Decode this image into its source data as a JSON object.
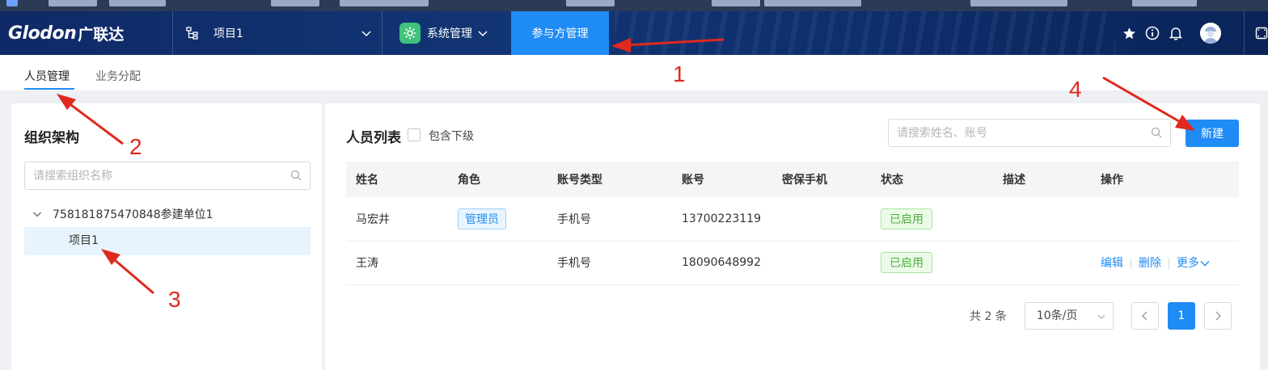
{
  "brand": {
    "logo_en": "Glodon",
    "logo_cn": "广联达"
  },
  "header": {
    "project_selector": "项目1",
    "system_menu": "系统管理",
    "active_tab": "参与方管理",
    "icons": [
      "star-icon",
      "info-icon",
      "bell-icon",
      "avatar",
      "fullscreen-icon"
    ]
  },
  "subtabs": [
    {
      "label": "人员管理",
      "active": true
    },
    {
      "label": "业务分配",
      "active": false
    }
  ],
  "left_panel": {
    "title": "组织架构",
    "search_placeholder": "请搜索组织名称",
    "tree": {
      "root": "758181875470848参建单位1",
      "child": "项目1"
    }
  },
  "right_panel": {
    "title": "人员列表",
    "include_sub_label": "包含下级",
    "search_placeholder": "请搜索姓名、账号",
    "new_button": "新建",
    "columns": [
      "姓名",
      "角色",
      "账号类型",
      "账号",
      "密保手机",
      "状态",
      "描述",
      "操作"
    ],
    "rows": [
      {
        "name": "马宏井",
        "role": "管理员",
        "account_type": "手机号",
        "account": "13700223119",
        "phone": "",
        "status": "已启用",
        "desc": "",
        "ops": []
      },
      {
        "name": "王涛",
        "role": "",
        "account_type": "手机号",
        "account": "18090648992",
        "phone": "",
        "status": "已启用",
        "desc": "",
        "ops": [
          "编辑",
          "删除",
          "更多"
        ]
      }
    ],
    "pagination": {
      "total_text": "共 2 条",
      "page_size": "10条/页",
      "current_page": "1"
    }
  },
  "annotations": [
    "1",
    "2",
    "3",
    "4"
  ],
  "colors": {
    "primary": "#1f8bf5",
    "nav_bg": "#0f2a66",
    "annotation_red": "#e0291e",
    "status_green": "#4caf3a"
  }
}
